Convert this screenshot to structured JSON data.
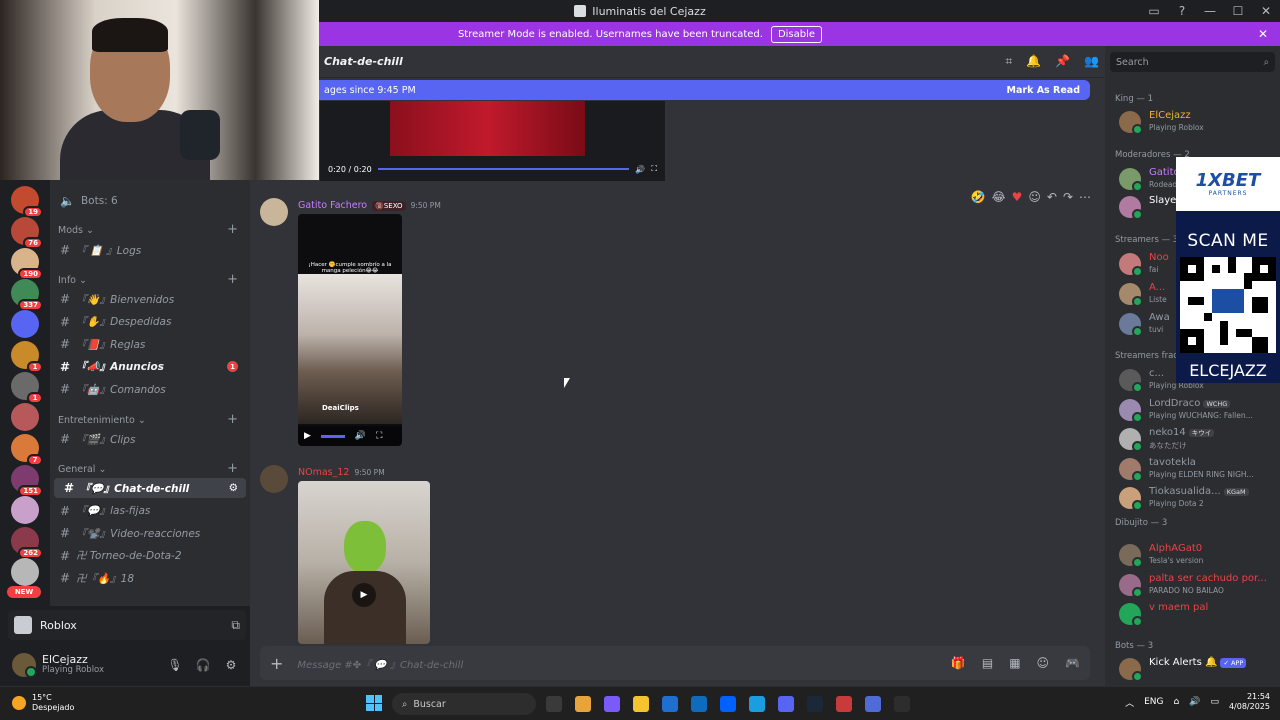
{
  "window": {
    "title": "Iluminatis del Cejazz",
    "controls": [
      "—",
      "☐",
      "✕"
    ]
  },
  "banner": {
    "text": "Streamer Mode is enabled. Usernames have been truncated.",
    "button": "Disable"
  },
  "servers": [
    {
      "color": "#c24a2e",
      "badge": "19"
    },
    {
      "color": "#b84838",
      "badge": "76"
    },
    {
      "color": "#d9b38a",
      "badge": "190"
    },
    {
      "color": "#3f8a57",
      "badge": "337"
    },
    {
      "color": "#5865f2",
      "badge": ""
    },
    {
      "color": "#c98a2a",
      "badge": "1"
    },
    {
      "color": "#6a6a6a",
      "badge": "1"
    },
    {
      "color": "#b7595b",
      "badge": ""
    },
    {
      "color": "#d97a3a",
      "badge": "7"
    },
    {
      "color": "#7e3b6e",
      "badge": "151"
    },
    {
      "color": "#c9a0c9",
      "badge": ""
    },
    {
      "color": "#8a3a4a",
      "badge": "262"
    },
    {
      "color": "#b7b7b7",
      "badge": ""
    }
  ],
  "new_badge": "NEW",
  "sidebar": {
    "bots_row": "Bots: 6",
    "mods_category": "Mods",
    "logs_channel": "『 📋 』Logs",
    "info_category": "Info",
    "info_channels": [
      "『👋』Bienvenidos",
      "『✋』Despedidas",
      "『📕』Reglas",
      "『📣』Anuncios",
      "『🤖』Comandos"
    ],
    "anuncios_unread": "1",
    "entretenimiento_category": "Entretenimiento",
    "clips_channel": "『🎬』Clips",
    "general_category": "General",
    "general_channels": [
      "『💬』Chat-de-chill",
      "『💬』las-fijas",
      "『📽️』Video-reacciones",
      "卍 Torneo-de-Dota-2",
      "卍『🔥』18"
    ]
  },
  "activity": {
    "name": "Roblox"
  },
  "user": {
    "name": "ElCejazz",
    "status": "Playing Roblox"
  },
  "chat": {
    "channel_name": "Chat-de-chill",
    "newbar_text": "ages since 9:45 PM",
    "mark_read": "Mark As Read",
    "embed_time": "0:20 / 0:20",
    "message1": {
      "author": "Gatito Fachero",
      "tag": "🔞SEXO",
      "time": "9:50 PM",
      "caption": "¡Hacer 🤫cumple sombrío a la manga peleción😂😂",
      "watermark": "DeaiClips"
    },
    "message2": {
      "author": "NOmas_12",
      "time": "9:50 PM"
    },
    "composer_placeholder": "Message #✤『 💬 』Chat-de-chill"
  },
  "search": {
    "placeholder": "Search"
  },
  "members": {
    "sections": [
      "King — 1",
      "Moderadores — 2",
      "Streamers — 3",
      "Streamers frac",
      "Dibujito — 3",
      "Bots — 3"
    ],
    "king": [
      {
        "name": "ElCejazz",
        "status": "Playing Roblox",
        "color": "#f0b232"
      }
    ],
    "mods": [
      {
        "name": "Gatito Fa",
        "status": "Rodeado de",
        "color": "#c77dff"
      },
      {
        "name": "Slayer",
        "status": "",
        "color": "#ffffff"
      }
    ],
    "streamers": [
      {
        "name": "Noo",
        "status": "fai",
        "color": "#ed4245"
      },
      {
        "name": "A...",
        "status": "Liste",
        "color": "#ed4245"
      },
      {
        "name": "Awa",
        "status": "tuvi",
        "color": "#949ba4"
      }
    ],
    "streamers_frac": [
      {
        "name": "c...",
        "status": "Playing Roblox",
        "color": "#949ba4",
        "tag": ""
      },
      {
        "name": "LordDraco",
        "status": "Playing WUCHANG: Fallen...",
        "color": "#949ba4",
        "tag": "WCHG"
      },
      {
        "name": "neko14",
        "status": "あなただけ",
        "color": "#949ba4",
        "tag": "キウイ"
      },
      {
        "name": "tavotekla",
        "status": "Playing ELDEN RING NIGH...",
        "color": "#949ba4",
        "tag": ""
      },
      {
        "name": "Tiokasualida...",
        "status": "Playing Dota 2",
        "color": "#949ba4",
        "tag": "KGaM"
      }
    ],
    "dibujito": [
      {
        "name": "AlphAGat0",
        "status": "Tesla's version",
        "color": "#ed4245"
      },
      {
        "name": "palta ser cachudo por...",
        "status": "PARADO NO BAILAO",
        "color": "#ed4245"
      },
      {
        "name": "v maem pal",
        "status": "",
        "color": "#ed4245"
      }
    ],
    "bots": [
      {
        "name": "Kick Alerts 🔔",
        "tag": "✓ APP",
        "color": "#ffffff"
      }
    ]
  },
  "ad": {
    "brand": "1XBET",
    "sub": "PARTNERS",
    "scan": "SCAN ME",
    "name": "ELCEJAZZ"
  },
  "taskbar": {
    "temp": "15°C",
    "weather": "Despejado",
    "search": "Buscar",
    "lang": "ENG",
    "time": "21:54",
    "date": "4/08/2025",
    "apps": [
      "#3a3a3a",
      "#e8a33a",
      "#7a5af8",
      "#f4c430",
      "#1f6fd1",
      "#0f6cbd",
      "#0061fe",
      "#1b9de2",
      "#5865f2",
      "#1b2838",
      "#c83b3b",
      "#4f6bd8",
      "#2d2d2d"
    ]
  }
}
